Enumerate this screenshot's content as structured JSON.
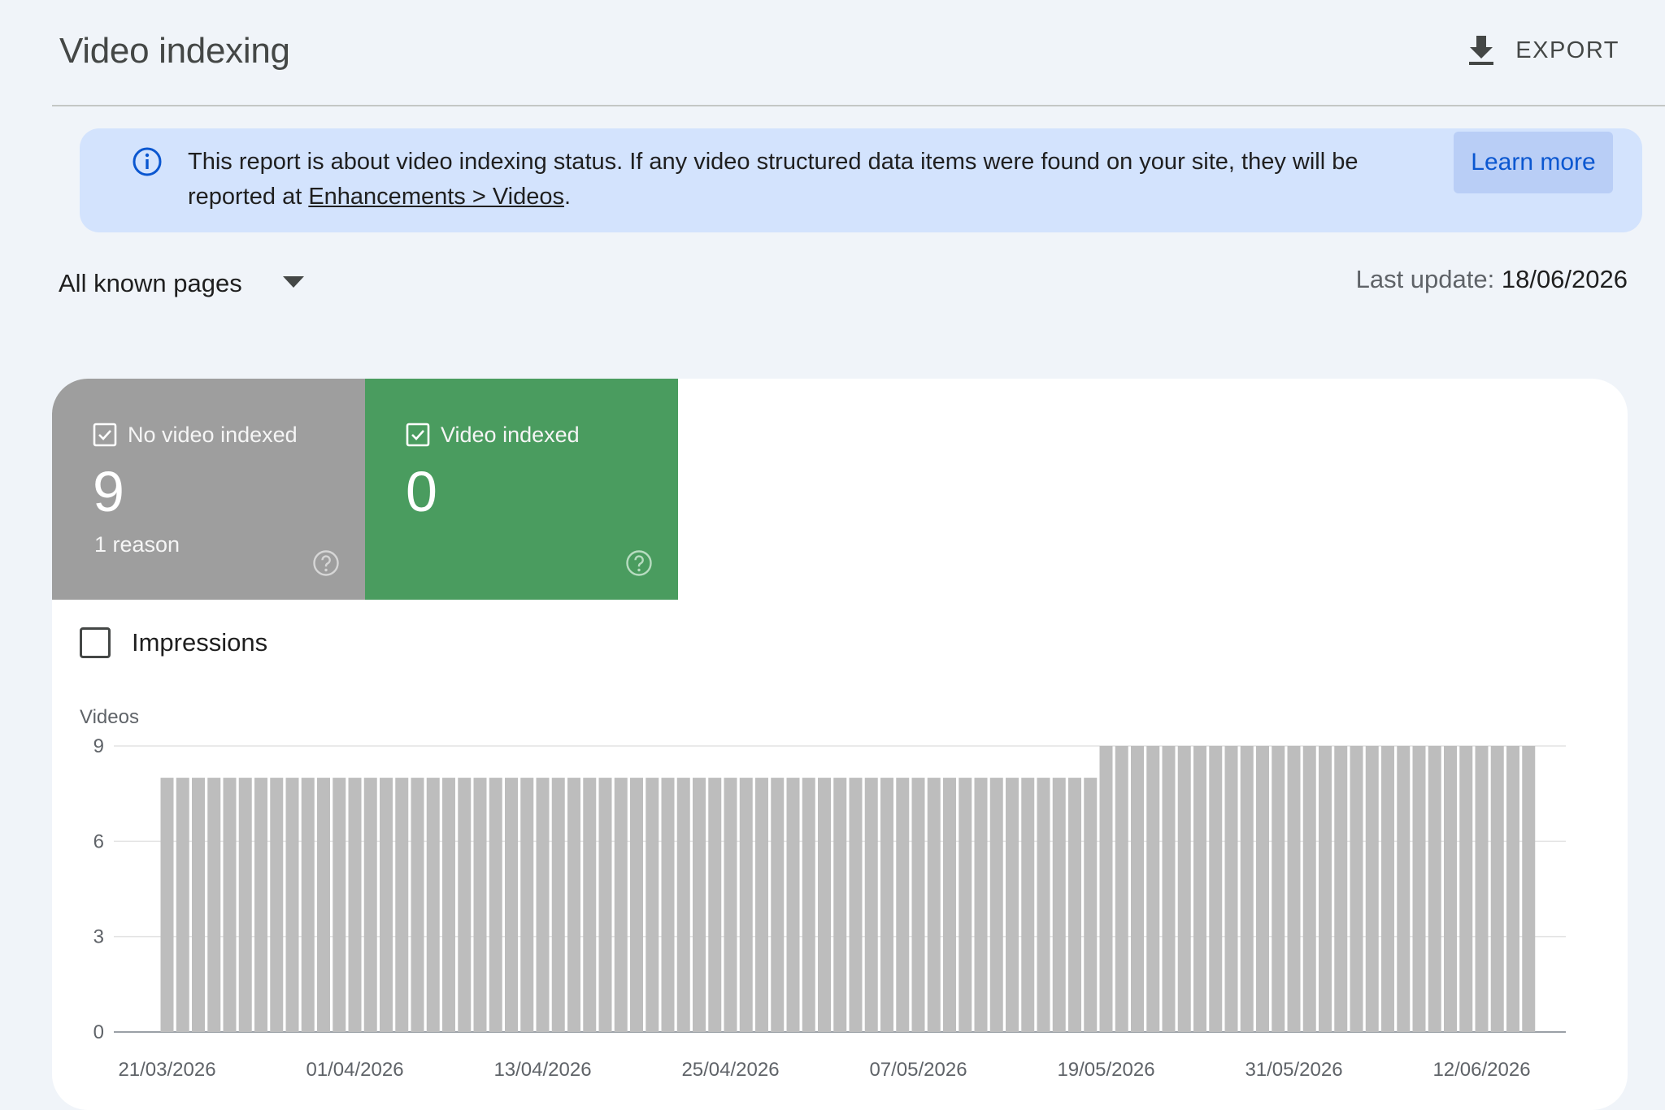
{
  "header": {
    "title": "Video indexing",
    "export_label": "EXPORT"
  },
  "info_banner": {
    "text_before": "This report is about video indexing status. If any video structured data items were found on your site, they will be reported at ",
    "link_text": "Enhancements > Videos",
    "text_after": ".",
    "learn_more_label": "Learn more"
  },
  "filters": {
    "pages_selected": "All known pages",
    "last_update_label": "Last update: ",
    "last_update_value": "18/06/2026"
  },
  "tiles": [
    {
      "label": "No video indexed",
      "value": "9",
      "sub": "1 reason",
      "color": "#9e9e9e"
    },
    {
      "label": "Video indexed",
      "value": "0",
      "sub": "",
      "color": "#4a9c5f"
    }
  ],
  "impressions_label": "Impressions",
  "colors": {
    "background": "#f0f4f9",
    "banner": "#d3e3fd",
    "accent_blue": "#0b57d0",
    "bar": "#bdbdbd"
  },
  "chart_data": {
    "type": "bar",
    "ylabel": "Videos",
    "ylim": [
      0,
      9
    ],
    "yticks": [
      0,
      3,
      6,
      9
    ],
    "x_start": "21/03/2026",
    "x_tick_labels": [
      "21/03/2026",
      "01/04/2026",
      "13/04/2026",
      "25/04/2026",
      "07/05/2026",
      "19/05/2026",
      "31/05/2026",
      "12/06/2026"
    ],
    "series": [
      {
        "values": [
          8,
          8,
          8,
          8,
          8,
          8,
          8,
          8,
          8,
          8,
          8,
          8,
          8,
          8,
          8,
          8,
          8,
          8,
          8,
          8,
          8,
          8,
          8,
          8,
          8,
          8,
          8,
          8,
          8,
          8,
          8,
          8,
          8,
          8,
          8,
          8,
          8,
          8,
          8,
          8,
          8,
          8,
          8,
          8,
          8,
          8,
          8,
          8,
          8,
          8,
          8,
          8,
          8,
          8,
          8,
          8,
          8,
          8,
          8,
          8,
          9,
          9,
          9,
          9,
          9,
          9,
          9,
          9,
          9,
          9,
          9,
          9,
          9,
          9,
          9,
          9,
          9,
          9,
          9,
          9,
          9,
          9,
          9,
          9,
          9,
          9,
          9,
          9
        ]
      }
    ],
    "grid": true
  }
}
